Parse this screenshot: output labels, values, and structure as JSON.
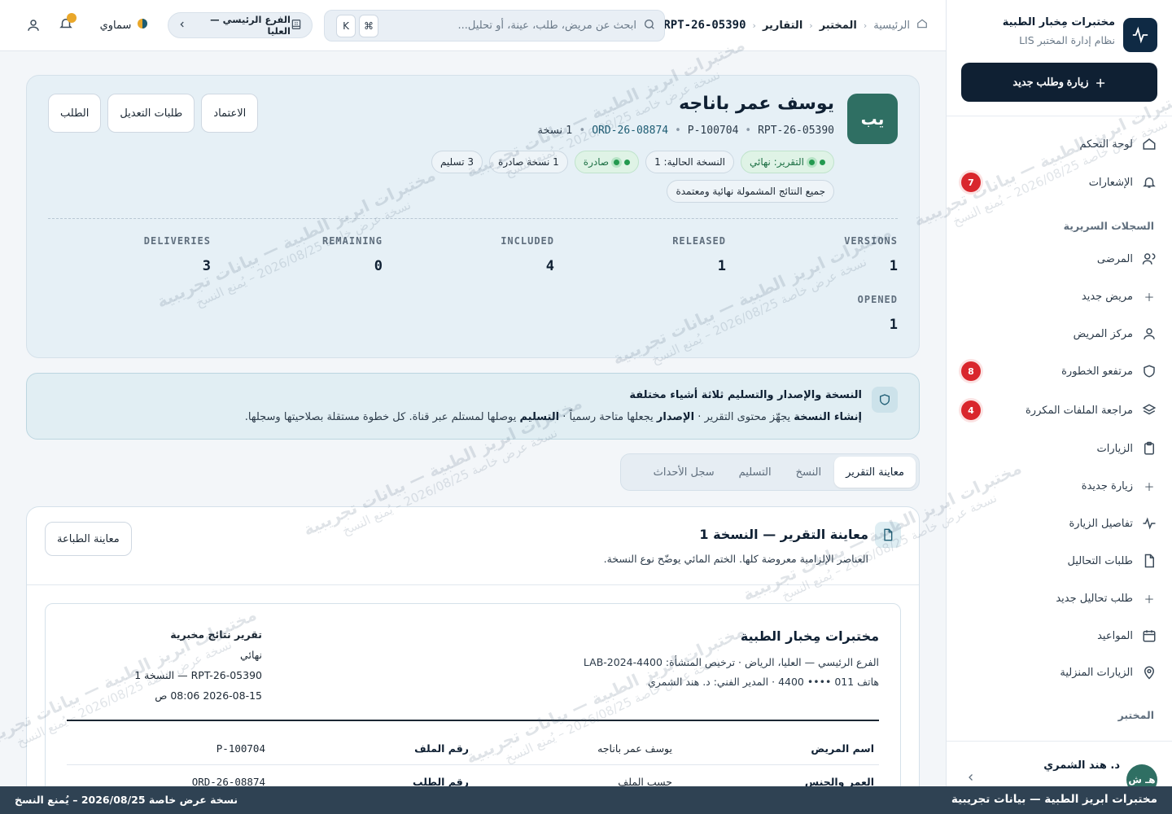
{
  "brand": {
    "title": "مختبرات مِخبار الطبية",
    "subtitle": "نظام إدارة المختبر LIS",
    "new_visit_label": "زيارة وطلب جديد"
  },
  "sidebar": {
    "items": [
      {
        "label": "لوحة التحكم",
        "icon": "home-icon"
      },
      {
        "label": "الإشعارات",
        "icon": "bell-icon",
        "badge": "7"
      },
      {
        "label": "المرضى",
        "icon": "users-icon"
      },
      {
        "label": "مريض جديد",
        "icon": "plus-icon"
      },
      {
        "label": "مركز المريض",
        "icon": "user-icon"
      },
      {
        "label": "مرتفعو الخطورة",
        "icon": "shield-icon",
        "badge": "8"
      },
      {
        "label": "مراجعة الملفات المكررة",
        "icon": "layers-icon",
        "badge": "4"
      },
      {
        "label": "الزيارات",
        "icon": "clipboard-icon"
      },
      {
        "label": "زيارة جديدة",
        "icon": "plus-icon"
      },
      {
        "label": "تفاصيل الزيارة",
        "icon": "activity-icon"
      },
      {
        "label": "طلبات التحاليل",
        "icon": "file-icon"
      },
      {
        "label": "طلب تحاليل جديد",
        "icon": "plus-icon"
      },
      {
        "label": "المواعيد",
        "icon": "calendar-icon"
      },
      {
        "label": "الزيارات المنزلية",
        "icon": "map-pin-icon"
      }
    ],
    "sections": {
      "clinical": "السجلات السريرية",
      "lab": "المختبر"
    },
    "user": {
      "initials": "هـ ش",
      "name": "د. هند الشمري"
    }
  },
  "topbar": {
    "breadcrumbs": [
      "الرئيسية",
      "المختبر",
      "التقارير"
    ],
    "current_id": "RPT-26-05390",
    "search_placeholder": "ابحث عن مريض، طلب، عينة، أو تحليل...",
    "shortcut_cmd": "⌘",
    "shortcut_key": "K",
    "branch": "الفرع الرئيسي — العليا",
    "theme": "سماوي"
  },
  "patient": {
    "initials": "يب",
    "name": "يوسف عمر باناجه",
    "report_id": "RPT-26-05390",
    "patient_id": "P-100704",
    "order_id": "ORD-26-08874",
    "copies": "1 نسخة",
    "chips": {
      "report_final": "التقرير: نهائي",
      "current_version": "النسخة الحالية: 1",
      "released": "صادرة",
      "released_count": "1 نسخة صادرة",
      "deliveries": "3 تسليم",
      "all_final": "جميع النتائج المشمولة نهائية ومعتمدة"
    },
    "buttons": {
      "approval": "الاعتماد",
      "amendments": "طلبات التعديل",
      "order": "الطلب"
    }
  },
  "stats": {
    "versions": {
      "label": "VERSIONS",
      "value": "1"
    },
    "released": {
      "label": "RELEASED",
      "value": "1"
    },
    "included": {
      "label": "INCLUDED",
      "value": "4"
    },
    "remaining": {
      "label": "REMAINING",
      "value": "0"
    },
    "deliveries": {
      "label": "DELIVERIES",
      "value": "3"
    },
    "opened": {
      "label": "OPENED",
      "value": "1"
    }
  },
  "notice": {
    "title": "النسخة والإصدار والتسليم ثلاثة أشياء مختلفة",
    "b1": "إنشاء النسخة",
    "t1": " يجهّز محتوى التقرير · ",
    "b2": "الإصدار",
    "t2": " يجعلها متاحة رسمياً · ",
    "b3": "التسليم",
    "t3": " يوصلها لمستلم عبر قناة. كل خطوة مستقلة بصلاحيتها وسجلها."
  },
  "tabs": [
    "معاينة التقرير",
    "النسخ",
    "التسليم",
    "سجل الأحداث"
  ],
  "preview": {
    "title": "معاينة التقرير — النسخة 1",
    "subtitle": "العناصر الإلزامية معروضة كلها. الختم المائي يوضّح نوع النسخة.",
    "print_label": "معاينة الطباعة",
    "lab_name": "مختبرات مِخبار الطبية",
    "lab_line1": "الفرع الرئيسي — العليا، الرياض · ترخيص المنشأة: LAB-2024-4400",
    "lab_line2": "هاتف 011 •••• 4400 · المدير الفني: د. هند الشمري",
    "report_title": "تقرير نتائج مخبرية",
    "report_status": "نهائي",
    "report_version": "RPT-26-05390 — النسخة 1",
    "report_date": "2026-08-15 08:06 ص",
    "rows": [
      {
        "k1": "اسم المريض",
        "v1": "يوسف عمر باناجه",
        "k2": "رقم الملف",
        "v2": "P-100704"
      },
      {
        "k1": "العمر والجنس",
        "v1": "حسب الملف",
        "k2": "رقم الطلب",
        "v2": "ORD-26-08874"
      }
    ]
  },
  "watermark": {
    "line1": "مختبرات ابريز الطبية — بيانات تجريبية",
    "line2": "نسخة عرض خاصة 2026/08/25 – يُمنع النسخ"
  },
  "footer": {
    "right": "مختبرات ابريز الطبية — بيانات تجريبية",
    "left": "نسخة عرض خاصة 2026/08/25 – يُمنع النسخ"
  }
}
